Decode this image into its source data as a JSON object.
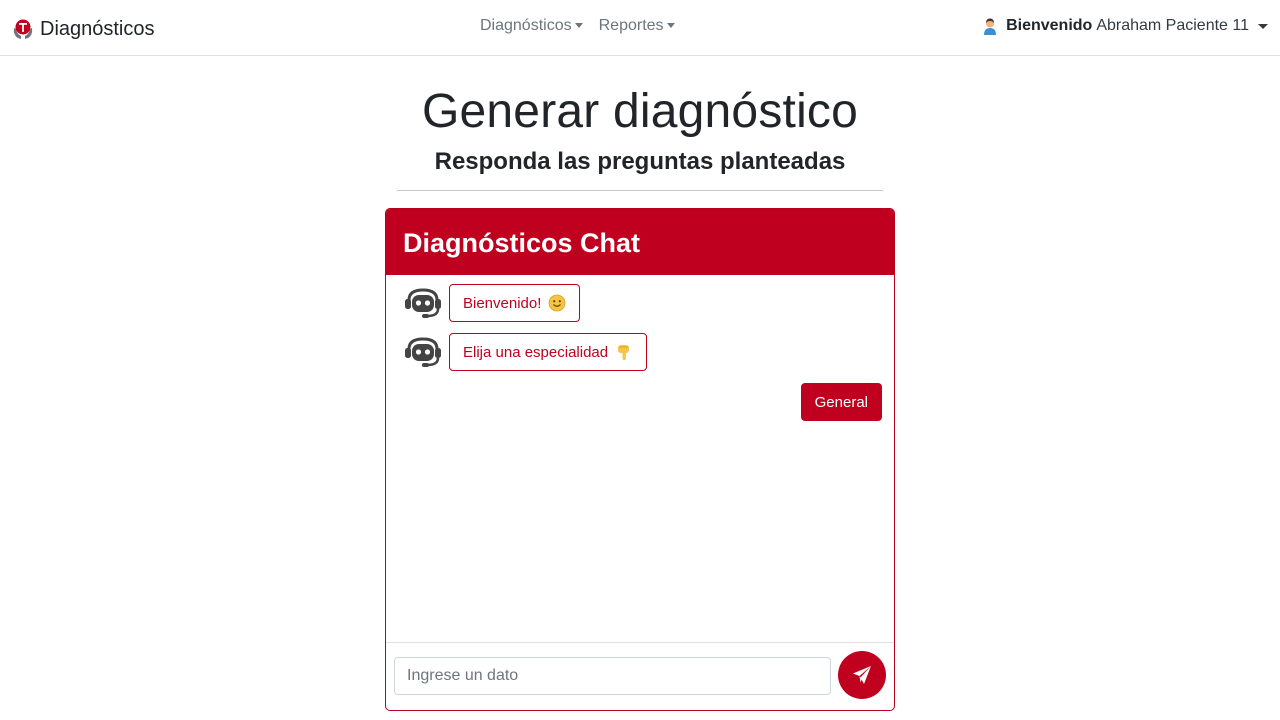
{
  "navbar": {
    "brand": "Diagnósticos",
    "menu": [
      {
        "label": "Diagnósticos"
      },
      {
        "label": "Reportes"
      }
    ],
    "user": {
      "greeting": "Bienvenido",
      "name": "Abraham Paciente 11"
    }
  },
  "page": {
    "title": "Generar diagnóstico",
    "subtitle": "Responda las preguntas planteadas"
  },
  "chat": {
    "header": "Diagnósticos Chat",
    "messages": [
      {
        "text": "Bienvenido!",
        "emoji": "smiley-emoji"
      },
      {
        "text": "Elija una especialidad",
        "emoji": "pointing-down-emoji"
      }
    ],
    "options": [
      {
        "label": "General"
      }
    ],
    "input": {
      "placeholder": "Ingrese un dato",
      "value": ""
    }
  },
  "colors": {
    "accent": "#c0001f",
    "text": "#212529",
    "muted": "#6c757d"
  },
  "icons": [
    "brand-logo-icon",
    "user-avatar-icon",
    "bot-icon",
    "send-icon"
  ]
}
